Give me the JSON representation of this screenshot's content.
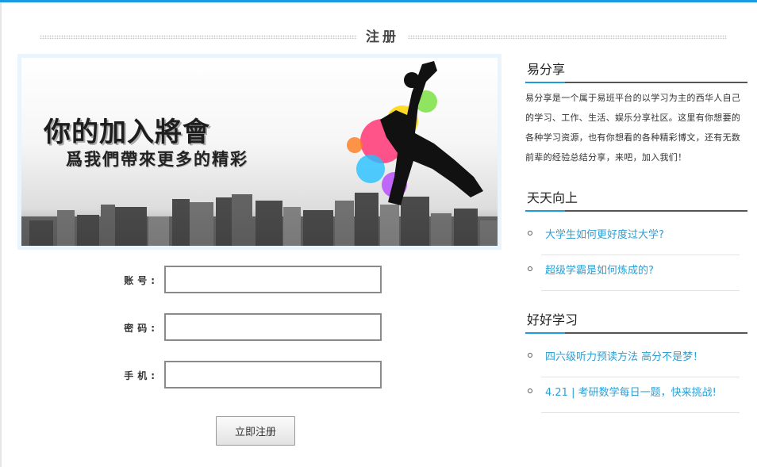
{
  "register": {
    "title": "注册"
  },
  "banner": {
    "line1": "你的加入將會",
    "line2": "爲我們帶來更多的精彩"
  },
  "form": {
    "account_label": "账号:",
    "password_label": "密码:",
    "phone_label": "手机:",
    "account_value": "",
    "password_value": "",
    "phone_value": "",
    "submit_label": "立即注册"
  },
  "sidebar": {
    "about": {
      "title": "易分享",
      "description": "易分享是一个属于易班平台的以学习为主的西华人自己的学习、工作、生活、娱乐分享社区。这里有你想要的各种学习资源，也有你想看的各种精彩博文，还有无数前辈的经验总结分享，来吧，加入我们！"
    },
    "daily": {
      "title": "天天向上",
      "links": [
        "大学生如何更好度过大学?",
        "超级学霸是如何炼成的?"
      ]
    },
    "study": {
      "title": "好好学习",
      "links": [
        "四六级听力预读方法 高分不是梦！",
        "4.21 | 考研数学每日一题，快来挑战!"
      ]
    }
  },
  "colors": {
    "accent": "#1a9be0",
    "link": "#2d9fd3"
  }
}
